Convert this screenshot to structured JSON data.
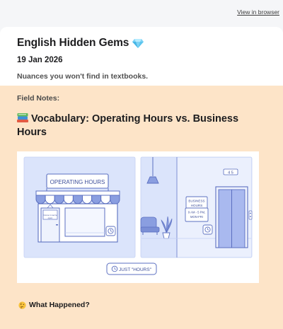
{
  "header": {
    "view_in_browser": "View in browser"
  },
  "newsletter": {
    "title": "English Hidden Gems",
    "date": "19 Jan 2026",
    "tagline": "Nuances you won't find in textbooks."
  },
  "section": {
    "label": "Field Notes:",
    "title": "Vocabulary: Operating Hours vs. Business Hours"
  },
  "illustration": {
    "left_sign": "OPERATING HOURS",
    "door_note": [
      "Come in we're",
      "open"
    ],
    "right_sign": [
      "BUSINESS",
      "HOURS"
    ],
    "right_plaque": [
      "9 AM - 5 PM,",
      "MON-FRI"
    ],
    "floor_indicator": "4 5",
    "bubble": "JUST \"HOURS\""
  },
  "next_heading": "What Happened?",
  "icons": {
    "title_emoji": "gem-icon",
    "section_emoji": "books-icon",
    "heading_emoji": "thinking-face-icon"
  },
  "colors": {
    "page_bg": "#f5f6f8",
    "body_bg": "#fde4c8",
    "panel_bg": "#dbe4fb",
    "line_blue": "#5b6fc0"
  }
}
